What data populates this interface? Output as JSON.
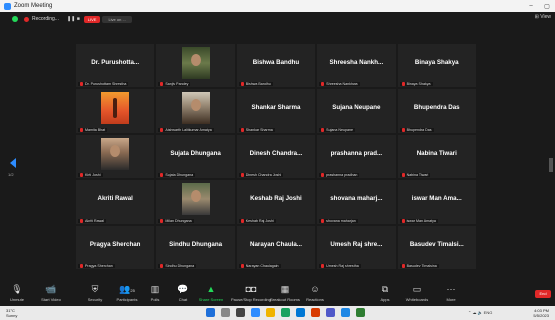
{
  "window": {
    "title": "Zoom Meeting",
    "minimize": "–",
    "maximize": "▢",
    "view_label": "View"
  },
  "topbar": {
    "recording_label": "Recording...",
    "pause_icon": "pause-icon",
    "stop_icon": "stop-icon",
    "live_chip": "LIVE",
    "gray_chip": "Live on ..."
  },
  "pager": {
    "page_left": "1/2"
  },
  "participants": [
    {
      "name": "Dr. Purushotta...",
      "label": "Dr. Purushottam Shrestha",
      "photo": ""
    },
    {
      "name": "",
      "label": "Sanjiv Pandey",
      "photo": "trees"
    },
    {
      "name": "Bishwa Bandhu",
      "label": "Bishwa Bandhu",
      "photo": ""
    },
    {
      "name": "Shreesha Nankh...",
      "label": "Shreesha Nankhwa",
      "photo": ""
    },
    {
      "name": "Binaya Shakya",
      "label": "Binaya Shakya",
      "photo": ""
    },
    {
      "name": "",
      "label": "Mamita Bhat",
      "photo": "yoga"
    },
    {
      "name": "",
      "label": "Aishwarth Lalitkumar Amatya",
      "photo": "man1"
    },
    {
      "name": "Shankar Sharma",
      "label": "Shankar Sharma",
      "photo": ""
    },
    {
      "name": "Sujana Neupane",
      "label": "Sujana Neupane",
      "photo": ""
    },
    {
      "name": "Bhupendra Das",
      "label": "Bhupendra Das",
      "photo": ""
    },
    {
      "name": "",
      "label": "Kirti Joshi",
      "photo": "man2"
    },
    {
      "name": "Sujata Dhungana",
      "label": "Sujata Dhungana",
      "photo": ""
    },
    {
      "name": "Dinesh Chandra...",
      "label": "Dinesh Chandra Joshi",
      "photo": ""
    },
    {
      "name": "prashanna prad...",
      "label": "prashanna pradhan",
      "photo": ""
    },
    {
      "name": "Nabina Tiwari",
      "label": "Nabina Tiwari",
      "photo": ""
    },
    {
      "name": "Akriti Rawal",
      "label": "Akriti Rawal",
      "photo": ""
    },
    {
      "name": "",
      "label": "Milan Dhungana",
      "photo": "man3"
    },
    {
      "name": "Keshab Raj Joshi",
      "label": "Keshab Raj Joshi",
      "photo": ""
    },
    {
      "name": "shovana maharj...",
      "label": "shovana maharjan",
      "photo": ""
    },
    {
      "name": "iswar Man Ama...",
      "label": "iswar Man Amatya",
      "photo": ""
    },
    {
      "name": "Pragya Sherchan",
      "label": "Pragya Sherchan",
      "photo": ""
    },
    {
      "name": "Sindhu Dhungana",
      "label": "Sindhu Dhungana",
      "photo": ""
    },
    {
      "name": "Narayan Chaula...",
      "label": "Narayan Chaulagain",
      "photo": ""
    },
    {
      "name": "Umesh Raj shre...",
      "label": "Umesh Raj shrestha",
      "photo": ""
    },
    {
      "name": "Basudev Timalsi...",
      "label": "Basudev Timalsina",
      "photo": ""
    }
  ],
  "toolbar": {
    "unmute": "Unmute",
    "start_video": "Start Video",
    "security": "Security",
    "participants": "Participants",
    "participants_count": "25",
    "polls": "Polls",
    "chat": "Chat",
    "share_screen": "Share Screen",
    "pause_recording": "Pause/Stop Recording",
    "breakout_rooms": "Breakout Rooms",
    "reactions": "Reactions",
    "apps": "Apps",
    "whiteboards": "Whiteboards",
    "more": "More",
    "end": "End"
  },
  "taskbar": {
    "weather_temp": "31°C",
    "weather_desc": "Sunny",
    "lang": "ENG",
    "time": "4:03 PM",
    "date": "5/5/2023"
  },
  "colors": {
    "accent": "#2d8cff",
    "green": "#23d959",
    "red": "#e02828",
    "tile": "#232323"
  }
}
